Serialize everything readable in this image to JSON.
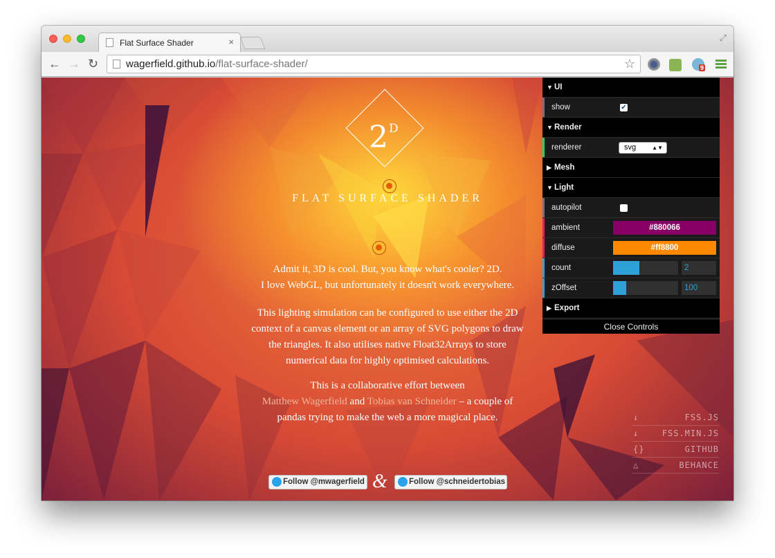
{
  "browser": {
    "tab_title": "Flat Surface Shader",
    "tab_close": "×",
    "url_host": "wagerfield.github.io",
    "url_path": "/flat-surface-shader/",
    "nav_back": "←",
    "nav_forward": "→",
    "nav_reload": "↻",
    "bookmark_star": "☆",
    "fullscreen": "⤢",
    "extension_badge": "9"
  },
  "hero": {
    "logo_main": "2",
    "logo_sup": "D",
    "title": "FLAT SURFACE SHADER",
    "p1_line1": "Admit it, 3D is cool. But, you know what's cooler? 2D.",
    "p1_line2": "I love WebGL, but unfortunately it doesn't work everywhere.",
    "p2": "This lighting simulation can be configured to use either the 2D context of a canvas element or an array of SVG polygons to draw the triangles. It also utilises native Float32Arrays to store numerical data for highly optimised calculations.",
    "p3_intro": "This is a collaborative effort between",
    "author1": "Matthew Wagerfield",
    "and": "and",
    "author2": "Tobias van Schneider",
    "p3_outro": "– a couple of pandas trying to make the web a more magical place."
  },
  "social": {
    "follow1": "Follow @mwagerfield",
    "ampersand": "&",
    "follow2": "Follow @schneidertobias"
  },
  "links": [
    {
      "icon": "↓",
      "label": "FSS.JS"
    },
    {
      "icon": "↓",
      "label": "FSS.MIN.JS"
    },
    {
      "icon": "{}",
      "label": "GITHUB"
    },
    {
      "icon": "△",
      "label": "BEHANCE"
    }
  ],
  "controls": {
    "arrow_open": "▼",
    "arrow_closed": "▶",
    "ui_folder": "UI",
    "show_label": "show",
    "check_mark": "✔",
    "render_folder": "Render",
    "renderer_label": "renderer",
    "renderer_value": "svg",
    "select_arrow": "▲▼",
    "mesh_folder": "Mesh",
    "light_folder": "Light",
    "autopilot_label": "autopilot",
    "ambient_label": "ambient",
    "ambient_value": "#880066",
    "diffuse_label": "diffuse",
    "diffuse_value": "#ff8800",
    "count_label": "count",
    "count_value": "2",
    "count_fill_fraction": 0.4,
    "zoffset_label": "zOffset",
    "zoffset_value": "100",
    "zoffset_fill_fraction": 0.2,
    "export_folder": "Export",
    "close_label": "Close Controls",
    "show_checked": true,
    "autopilot_checked": false
  },
  "colors": {
    "ambient": "#880066",
    "diffuse": "#ff8800",
    "slider_accent": "#2fa1d6",
    "stripe_boolean": "#806787",
    "stripe_option": "#1ed36f",
    "stripe_color": "#e61d5f",
    "stripe_number": "#2fa1d6"
  }
}
